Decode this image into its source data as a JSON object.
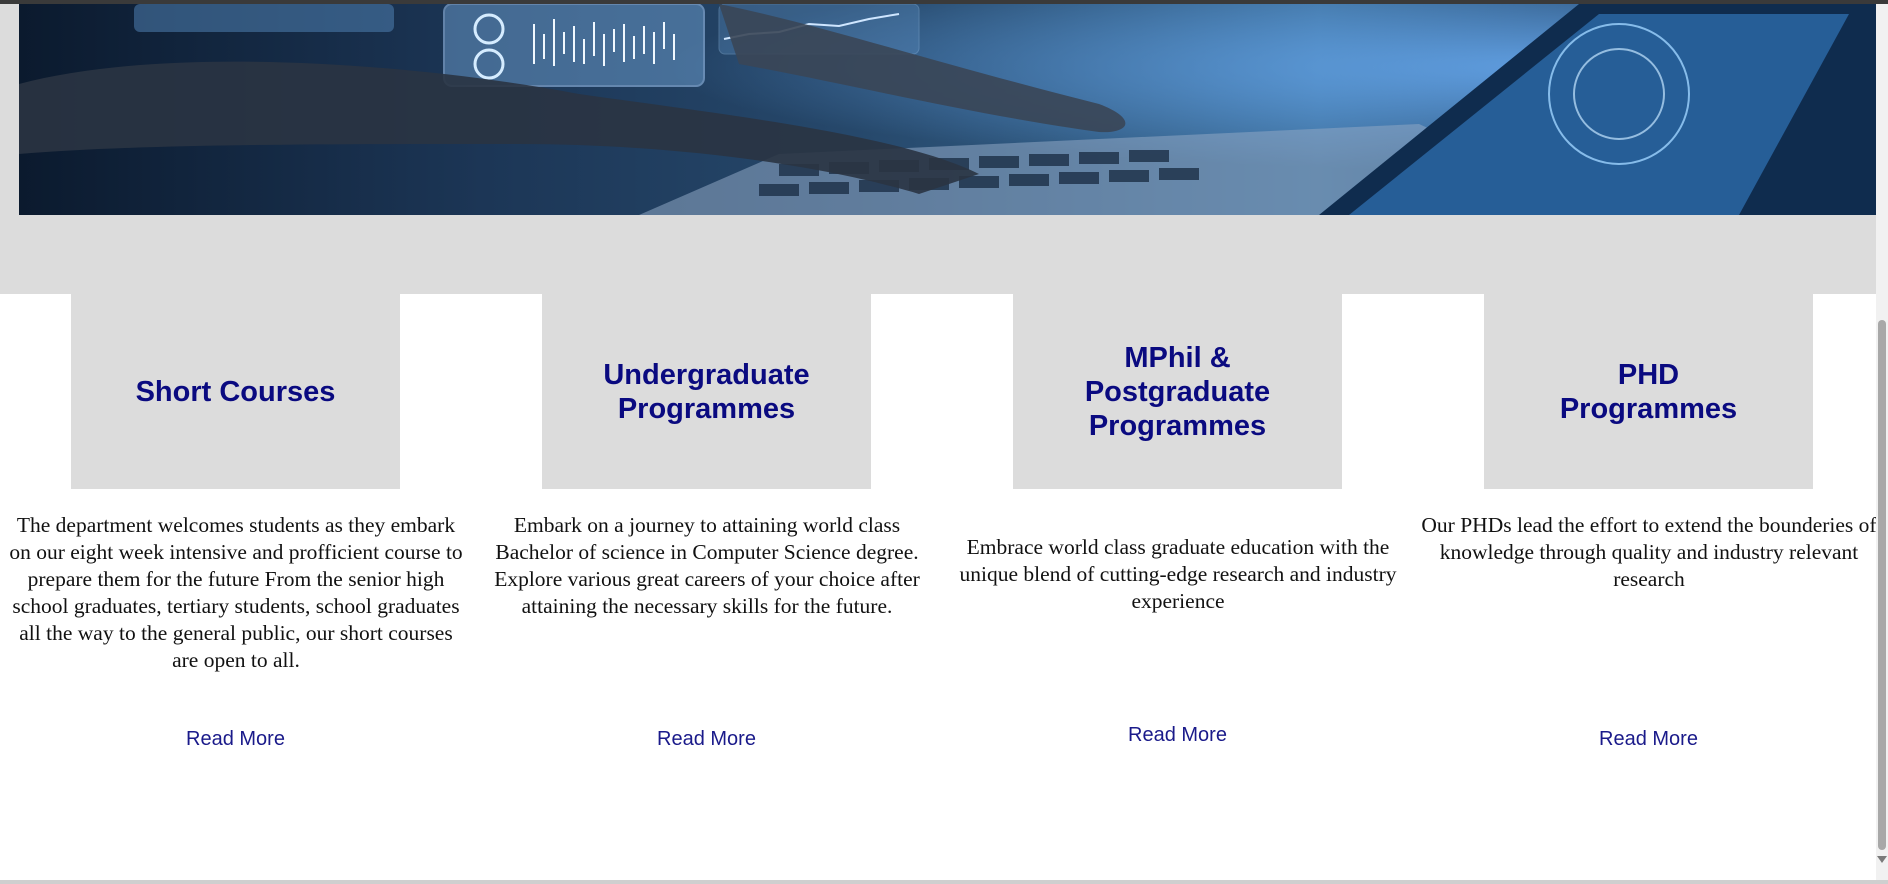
{
  "hero": {
    "image_icon": "laptop-typing-hero-image"
  },
  "cards": [
    {
      "title": "Short Courses",
      "description": "The department welcomes students as they embark on our eight week intensive and profficient course to prepare them for the future From the senior high school graduates, tertiary students, school graduates all the way to the general public, our short courses are open to all.",
      "link": "Read More"
    },
    {
      "title": "Undergraduate\nProgrammes",
      "description": "Embark on a journey to attaining world class Bachelor of science in Computer Science degree. Explore various great careers of your choice after attaining the necessary skills for the future.",
      "link": "Read More"
    },
    {
      "title": "MPhil &\nPostgraduate\nProgrammes",
      "description": "Embrace world class graduate education with the unique blend of cutting-edge research and industry experience",
      "link": "Read More"
    },
    {
      "title": "PHD\nProgrammes",
      "description": "Our PHDs lead the effort to extend the bounderies of knowledge through quality and industry relevant research",
      "link": "Read More"
    }
  ],
  "colors": {
    "title": "#0a0a80",
    "link": "#1a1a8a",
    "panel": "#dcdcdc"
  }
}
